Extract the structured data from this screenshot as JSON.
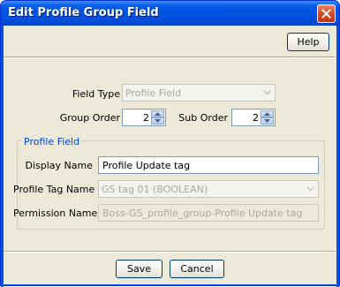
{
  "window": {
    "title": "Edit Profile Group Field",
    "close_glyph": "✕"
  },
  "toolbar": {
    "help_label": "Help"
  },
  "form": {
    "field_type": {
      "label": "Field Type",
      "value": "Profile Field"
    },
    "group_order": {
      "label": "Group Order",
      "value": "2"
    },
    "sub_order": {
      "label": "Sub Order",
      "value": "2"
    }
  },
  "profile_field": {
    "legend": "Profile Field",
    "display_name": {
      "label": "Display Name",
      "value": "Profile Update tag"
    },
    "profile_tag_name": {
      "label": "Profile Tag Name",
      "value": "GS tag 01 (BOOLEAN)"
    },
    "permission_name": {
      "label": "Permission Name",
      "value": "Boss-GS_profile_group-Profile Update tag"
    }
  },
  "footer": {
    "save_label": "Save",
    "cancel_label": "Cancel"
  },
  "colors": {
    "titlebar": "#0054e3",
    "dialog_bg": "#ece9d8",
    "group_legend": "#0046d5",
    "close_button": "#d24a2a"
  },
  "icons": {
    "close": "close-icon",
    "combo_arrow": "chevron-down-icon",
    "spin_up": "triangle-up-icon",
    "spin_down": "triangle-down-icon"
  }
}
